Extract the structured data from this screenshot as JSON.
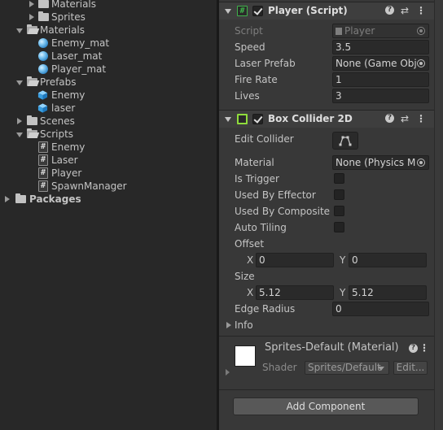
{
  "project": {
    "items": [
      {
        "label": "Materials",
        "indent": 2,
        "type": "folder",
        "expanded": false
      },
      {
        "label": "Sprites",
        "indent": 2,
        "type": "folder",
        "expanded": false
      },
      {
        "label": "Materials",
        "indent": 1,
        "type": "folder",
        "expanded": true
      },
      {
        "label": "Enemy_mat",
        "indent": 2,
        "type": "material"
      },
      {
        "label": "Laser_mat",
        "indent": 2,
        "type": "material"
      },
      {
        "label": "Player_mat",
        "indent": 2,
        "type": "material"
      },
      {
        "label": "Prefabs",
        "indent": 1,
        "type": "folder",
        "expanded": true
      },
      {
        "label": "Enemy",
        "indent": 2,
        "type": "prefab"
      },
      {
        "label": "laser",
        "indent": 2,
        "type": "prefab"
      },
      {
        "label": "Scenes",
        "indent": 1,
        "type": "folder",
        "expanded": false
      },
      {
        "label": "Scripts",
        "indent": 1,
        "type": "folder",
        "expanded": true
      },
      {
        "label": "Enemy",
        "indent": 2,
        "type": "script"
      },
      {
        "label": "Laser",
        "indent": 2,
        "type": "script"
      },
      {
        "label": "Player",
        "indent": 2,
        "type": "script"
      },
      {
        "label": "SpawnManager",
        "indent": 2,
        "type": "script"
      },
      {
        "label": "Packages",
        "indent": 0,
        "type": "folder",
        "expanded": false
      }
    ]
  },
  "inspector": {
    "player_script": {
      "title": "Player (Script)",
      "enabled": true,
      "script_label": "Script",
      "script_value": "Player",
      "speed_label": "Speed",
      "speed_value": "3.5",
      "laser_prefab_label": "Laser Prefab",
      "laser_prefab_value": "None (Game Obje",
      "fire_rate_label": "Fire Rate",
      "fire_rate_value": "1",
      "lives_label": "Lives",
      "lives_value": "3"
    },
    "box_collider": {
      "title": "Box Collider 2D",
      "enabled": true,
      "edit_collider_label": "Edit Collider",
      "material_label": "Material",
      "material_value": "None (Physics M",
      "is_trigger_label": "Is Trigger",
      "used_by_effector_label": "Used By Effector",
      "used_by_composite_label": "Used By Composite",
      "auto_tiling_label": "Auto Tiling",
      "offset_label": "Offset",
      "offset_x_label": "X",
      "offset_x": "0",
      "offset_y_label": "Y",
      "offset_y": "0",
      "size_label": "Size",
      "size_x_label": "X",
      "size_x": "5.12",
      "size_y_label": "Y",
      "size_y": "5.12",
      "edge_radius_label": "Edge Radius",
      "edge_radius_value": "0",
      "info_label": "Info"
    },
    "material_section": {
      "title": "Sprites-Default (Material)",
      "shader_label": "Shader",
      "shader_value": "Sprites/Default",
      "edit_label": "Edit..."
    },
    "add_component_label": "Add Component"
  },
  "colors": {
    "panel_bg": "#282828",
    "inspector_bg": "#383838",
    "script_icon_green": "#3fb24a",
    "collider_icon_green": "#8fdc3c"
  }
}
